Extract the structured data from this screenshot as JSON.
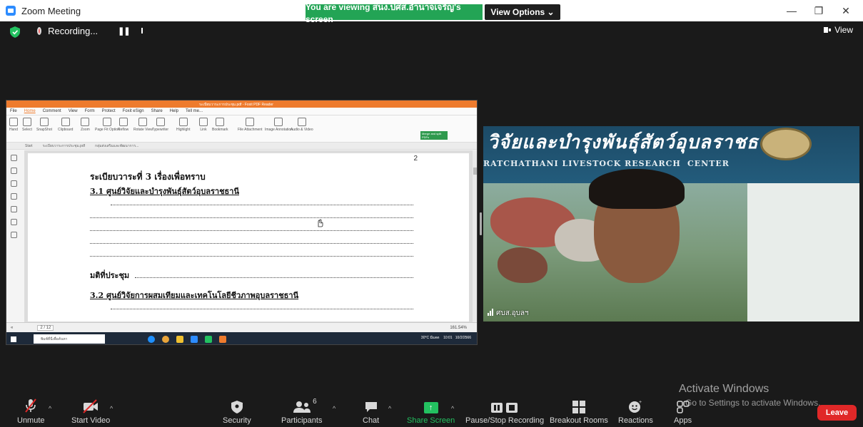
{
  "window": {
    "title": "Zoom Meeting",
    "viewing_banner": "You are viewing สนง.ปศส.อำนาจเจริญ's screen",
    "view_options": "View Options ⌄",
    "minimize": "—",
    "restore": "❐",
    "close": "✕"
  },
  "status": {
    "recording_label": "Recording...",
    "pause_glyph": "❚❚",
    "view_label": "View"
  },
  "shared_screen": {
    "app_title": "ระเบียบวาระการประชุม.pdf - Foxit PDF Reader",
    "menu": [
      "File",
      "Home",
      "Comment",
      "View",
      "Form",
      "Protect",
      "Foxit eSign",
      "Share",
      "Help",
      "Tell me..."
    ],
    "ribbon": [
      "Hand",
      "Select",
      "SnapShot",
      "Clipboard",
      "Zoom",
      "Page Fit Option",
      "Reflow",
      "Rotate View",
      "Typewriter",
      "Highlight",
      "Link",
      "Bookmark",
      "File Attachment",
      "Image Annotation",
      "Audio & Video"
    ],
    "merge_badge": "Merge and split PDFs",
    "tabs": [
      "Start",
      "ระเบียบวาระการประชุม.pdf",
      "กลุ่มส่งเสริมและพัฒนาการ..."
    ],
    "page_number": "2",
    "agenda_heading": "ระเบียบวาระที่  3     เรื่องเพื่อทราบ",
    "item_1": "3.1 ศูนย์วิจัยและบำรุงพันธุ์สัตว์อุบลราชธานี",
    "resolution": "มติที่ประชุม",
    "item_2": "3.2 ศูนย์วิจัยการผสมเทียมและเทคโนโลยีชีวภาพอุบลราชธานี",
    "page_indicator": "2 / 12",
    "zoom_level": "161.54%",
    "taskbar_search": "พิมพ์ที่นี่เพื่อค้นหา",
    "taskbar_weather": "30°C มีแดด",
    "taskbar_time": "10:01",
    "taskbar_date": "10/2/2566"
  },
  "video": {
    "banner_thai": "วิจัยและบำรุงพันธุ์สัตว์อุบลราชธานี",
    "banner_eng_left": "RATCHATHANI LIVESTOCK RESEARCH",
    "banner_eng_right": "CENTER",
    "participant_name": "ศบส.อุบลฯ"
  },
  "watermark": {
    "title": "Activate Windows",
    "subtitle": "Go to Settings to activate Windows."
  },
  "toolbar": {
    "unmute": "Unmute",
    "start_video": "Start Video",
    "security": "Security",
    "participants": "Participants",
    "participants_count": "6",
    "chat": "Chat",
    "share_screen": "Share Screen",
    "pause_stop_recording": "Pause/Stop Recording",
    "breakout_rooms": "Breakout Rooms",
    "reactions": "Reactions",
    "apps": "Apps",
    "leave": "Leave"
  },
  "colors": {
    "banner_green": "#23a455",
    "share_green": "#23c160",
    "leave_red": "#e02828",
    "foxit_orange": "#ee7b2d"
  }
}
